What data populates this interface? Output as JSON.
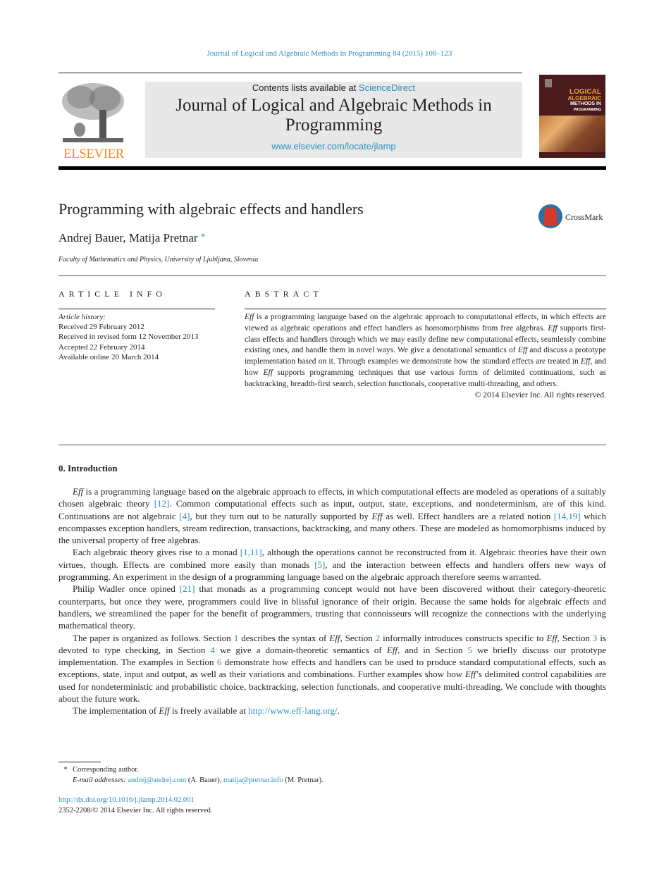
{
  "header": {
    "running_head": "Journal of Logical and Algebraic Methods in Programming 84 (2015) 108–123",
    "publisher_logo_text": "ELSEVIER",
    "contents_prefix": "Contents lists available at ",
    "contents_link": "ScienceDirect",
    "journal_title": "Journal of Logical and Algebraic Methods in Programming",
    "journal_url": "www.elsevier.com/locate/jlamp",
    "cover": {
      "line1": "LOGICAL",
      "line2": "ALGEBRAIC",
      "line3": "METHODS IN",
      "line4": "PROGRAMMING"
    }
  },
  "article": {
    "title": "Programming with algebraic effects and handlers",
    "crossmark_label": "CrossMark",
    "authors": "Andrej Bauer, Matija Pretnar",
    "author_mark": "*",
    "affiliation": "Faculty of Mathematics and Physics, University of Ljubljana, Slovenia"
  },
  "article_info": {
    "heading": "ARTICLE INFO",
    "history_label": "Article history:",
    "history": [
      "Received 29 February 2012",
      "Received in revised form 12 November 2013",
      "Accepted 22 February 2014",
      "Available online 20 March 2014"
    ]
  },
  "abstract": {
    "heading": "ABSTRACT",
    "segments": [
      {
        "t": "Eff",
        "i": true
      },
      {
        "t": " is a programming language based on the algebraic approach to computational effects, in which effects are viewed as algebraic operations and effect handlers as homomorphisms from free algebras. "
      },
      {
        "t": "Eff",
        "i": true
      },
      {
        "t": " supports first-class effects and handlers through which we may easily define new computational effects, seamlessly combine existing ones, and handle them in novel ways. We give a denotational semantics of "
      },
      {
        "t": "Eff",
        "i": true
      },
      {
        "t": " and discuss a prototype implementation based on it. Through examples we demonstrate how the standard effects are treated in "
      },
      {
        "t": "Eff",
        "i": true
      },
      {
        "t": ", and how "
      },
      {
        "t": "Eff",
        "i": true
      },
      {
        "t": " supports programming techniques that use various forms of delimited continuations, such as backtracking, breadth-first search, selection functionals, cooperative multi-threading, and others."
      }
    ],
    "copyright": "© 2014 Elsevier Inc. All rights reserved."
  },
  "introduction": {
    "heading": "0.  Introduction",
    "paragraphs": [
      [
        {
          "t": "Eff",
          "i": true
        },
        {
          "t": " is a programming language based on the algebraic approach to effects, in which computational effects are modeled as operations of a suitably chosen algebraic theory "
        },
        {
          "t": "[12]",
          "l": true
        },
        {
          "t": ". Common computational effects such as input, output, state, exceptions, and nondeterminism, are of this kind. Continuations are not algebraic "
        },
        {
          "t": "[4]",
          "l": true
        },
        {
          "t": ", but they turn out to be naturally supported by "
        },
        {
          "t": "Eff",
          "i": true
        },
        {
          "t": " as well. Effect handlers are a related notion "
        },
        {
          "t": "[14,19]",
          "l": true
        },
        {
          "t": " which encompasses exception handlers, stream redirection, transactions, backtracking, and many others. These are modeled as homomorphisms induced by the universal property of free algebras."
        }
      ],
      [
        {
          "t": "Each algebraic theory gives rise to a monad "
        },
        {
          "t": "[1,11]",
          "l": true
        },
        {
          "t": ", although the operations cannot be reconstructed from it. Algebraic theories have their own virtues, though. Effects are combined more easily than monads "
        },
        {
          "t": "[5]",
          "l": true
        },
        {
          "t": ", and the interaction between effects and handlers offers new ways of programming. An experiment in the design of a programming language based on the algebraic approach therefore seems warranted."
        }
      ],
      [
        {
          "t": "Philip Wadler once opined "
        },
        {
          "t": "[21]",
          "l": true
        },
        {
          "t": " that monads as a programming concept would not have been discovered without their category-theoretic counterparts, but once they were, programmers could live in blissful ignorance of their origin. Because the same holds for algebraic effects and handlers, we streamlined the paper for the benefit of programmers, trusting that connoisseurs will recognize the connections with the underlying mathematical theory."
        }
      ],
      [
        {
          "t": "The paper is organized as follows. Section "
        },
        {
          "t": "1",
          "l": true
        },
        {
          "t": " describes the syntax of "
        },
        {
          "t": "Eff",
          "i": true
        },
        {
          "t": ", Section "
        },
        {
          "t": "2",
          "l": true
        },
        {
          "t": " informally introduces constructs specific to "
        },
        {
          "t": "Eff",
          "i": true
        },
        {
          "t": ", Section "
        },
        {
          "t": "3",
          "l": true
        },
        {
          "t": " is devoted to type checking, in Section "
        },
        {
          "t": "4",
          "l": true
        },
        {
          "t": " we give a domain-theoretic semantics of "
        },
        {
          "t": "Eff",
          "i": true
        },
        {
          "t": ", and in Section "
        },
        {
          "t": "5",
          "l": true
        },
        {
          "t": " we briefly discuss our prototype implementation. The examples in Section "
        },
        {
          "t": "6",
          "l": true
        },
        {
          "t": " demonstrate how effects and handlers can be used to produce standard computational effects, such as exceptions, state, input and output, as well as their variations and combinations. Further examples show how "
        },
        {
          "t": "Eff",
          "i": true
        },
        {
          "t": "’s delimited control capabilities are used for nondeterministic and probabilistic choice, backtracking, selection functionals, and cooperative multi-threading. We conclude with thoughts about the future work."
        }
      ],
      [
        {
          "t": "The implementation of "
        },
        {
          "t": "Eff",
          "i": true
        },
        {
          "t": " is freely available at "
        },
        {
          "t": "http://www.eff-lang.org/",
          "l": true
        },
        {
          "t": "."
        }
      ]
    ]
  },
  "footnotes": {
    "star": "*",
    "corresponding": "Corresponding author.",
    "email_label": "E-mail addresses:",
    "email1": "andrej@andrej.com",
    "email1_owner": " (A. Bauer), ",
    "email2": "matija@pretnar.info",
    "email2_owner": " (M. Pretnar)."
  },
  "doi": {
    "link": "http://dx.doi.org/10.1016/j.jlamp.2014.02.001",
    "issn_line": "2352-2208/© 2014 Elsevier Inc. All rights reserved."
  },
  "colors": {
    "link": "#2a8fbd",
    "elsevier_orange": "#f28c28",
    "masthead_bg": "#e8e8e8",
    "text": "#231f20"
  }
}
